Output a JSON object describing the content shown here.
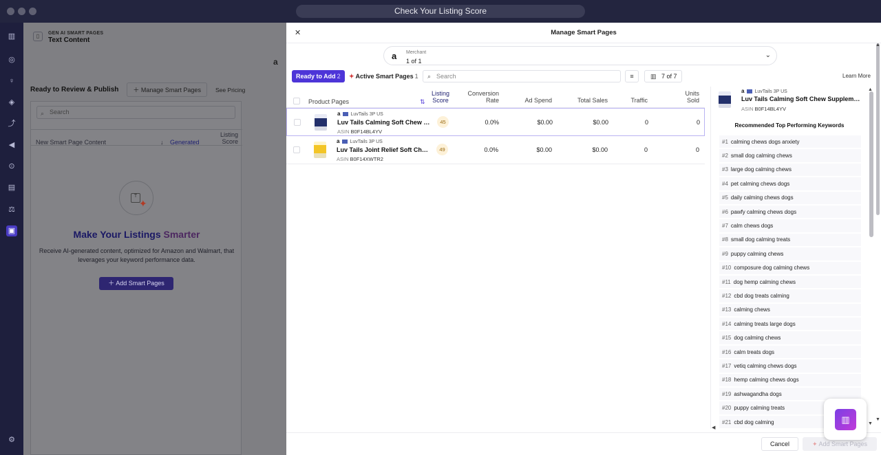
{
  "window": {
    "title": "Check Your Listing Score"
  },
  "rail": {
    "icons": [
      "dashboard-icon",
      "compass-icon",
      "bulb-icon",
      "cube-icon",
      "analytics-icon",
      "megaphone-icon",
      "target-icon",
      "chart-icon",
      "scale-icon",
      "smart-pages-icon",
      "settings-icon"
    ]
  },
  "left_panel": {
    "section_label": "GEN AI SMART PAGES",
    "title": "Text Content",
    "tab_ready": "Ready to Review & Publish",
    "tab_manage": "Manage Smart Pages",
    "tab_pricing": "See Pricing",
    "search_placeholder": "Search",
    "col_content": "New Smart Page Content",
    "col_generated": "Generated",
    "col_score": "Listing Score",
    "empty_title_a": "Make Your Listings ",
    "empty_title_b": "Smarter",
    "empty_text": "Receive AI-generated content, optimized for Amazon and Walmart, that leverages your keyword performance data.",
    "add_button": "Add Smart Pages"
  },
  "modal": {
    "title": "Manage Smart Pages",
    "merchant_label": "Merchant",
    "merchant_value": "1 of 1",
    "ready_tab": "Ready to Add",
    "ready_count": "2",
    "active_tab": "Active Smart Pages",
    "active_count": "1",
    "search_placeholder": "Search",
    "columns_count": "7 of 7",
    "learn_more": "Learn More",
    "headers": {
      "product": "Product Pages",
      "score_1": "Listing",
      "score_2": "Score",
      "conv_1": "Conversion",
      "conv_2": "Rate",
      "adspend": "Ad Spend",
      "sales": "Total Sales",
      "traffic": "Traffic",
      "units_1": "Units",
      "units_2": "Sold"
    },
    "rows": [
      {
        "merchant": "LuvTails 3P US",
        "name": "Luv Tails Calming Soft Chew S...",
        "asin_label": "ASIN",
        "asin": "B0F14BL4YV",
        "score": "45",
        "conv": "0.0%",
        "adspend": "$0.00",
        "sales": "$0.00",
        "traffic": "0",
        "units": "0"
      },
      {
        "merchant": "LuvTails 3P US",
        "name": "Luv Tails Joint Relief Soft Chew...",
        "asin_label": "ASIN",
        "asin": "B0F14XWTR2",
        "score": "49",
        "conv": "0.0%",
        "adspend": "$0.00",
        "sales": "$0.00",
        "traffic": "0",
        "units": "0"
      }
    ],
    "detail": {
      "merchant": "LuvTails 3P US",
      "name": "Luv Tails Calming Soft Chew Supplement...",
      "asin_label": "ASIN",
      "asin": "B0F14BL4YV",
      "keywords_title": "Recommended Top Performing Keywords",
      "keywords": [
        {
          "n": "#1",
          "k": "calming chews dogs anxiety"
        },
        {
          "n": "#2",
          "k": "small dog calming chews"
        },
        {
          "n": "#3",
          "k": "large dog calming chews"
        },
        {
          "n": "#4",
          "k": "pet calming chews dogs"
        },
        {
          "n": "#5",
          "k": "daily calming chews dogs"
        },
        {
          "n": "#6",
          "k": "pawfy calming chews dogs"
        },
        {
          "n": "#7",
          "k": "calm chews dogs"
        },
        {
          "n": "#8",
          "k": "small dog calming treats"
        },
        {
          "n": "#9",
          "k": "puppy calming chews"
        },
        {
          "n": "#10",
          "k": "composure dog calming chews"
        },
        {
          "n": "#11",
          "k": "dog hemp calming chews"
        },
        {
          "n": "#12",
          "k": "cbd dog treats calming"
        },
        {
          "n": "#13",
          "k": "calming chews"
        },
        {
          "n": "#14",
          "k": "calming treats large dogs"
        },
        {
          "n": "#15",
          "k": "dog calming chews"
        },
        {
          "n": "#16",
          "k": "calm treats dogs"
        },
        {
          "n": "#17",
          "k": "vetiq calming chews dogs"
        },
        {
          "n": "#18",
          "k": "hemp calming chews dogs"
        },
        {
          "n": "#19",
          "k": "ashwagandha dogs"
        },
        {
          "n": "#20",
          "k": "puppy calming treats"
        },
        {
          "n": "#21",
          "k": "cbd dog calming"
        }
      ]
    },
    "cancel": "Cancel",
    "add": "Add Smart Pages"
  },
  "colors": {
    "accent": "#4d35d8",
    "score_bg": "#fdf1d8",
    "brand": "#c13bd9"
  }
}
